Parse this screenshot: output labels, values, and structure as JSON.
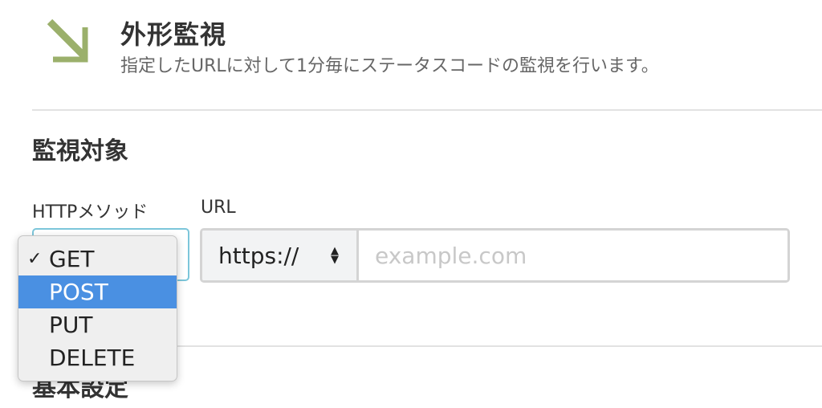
{
  "header": {
    "title": "外形監視",
    "description": "指定したURLに対して1分毎にステータスコードの監視を行います。",
    "icon": "arrow-down-right-icon",
    "icon_color": "#9bb06b"
  },
  "sections": {
    "target_heading": "監視対象",
    "basic_heading": "基本設定"
  },
  "fields": {
    "method_label": "HTTPメソッド",
    "url_label": "URL",
    "scheme_value": "https://",
    "url_placeholder": "example.com"
  },
  "method_dropdown": {
    "check_mark": "✓",
    "selected": "GET",
    "highlighted": "POST",
    "options": [
      "GET",
      "POST",
      "PUT",
      "DELETE"
    ]
  },
  "colors": {
    "highlight": "#4a90e2",
    "select_focus_border": "#7cc6da"
  }
}
